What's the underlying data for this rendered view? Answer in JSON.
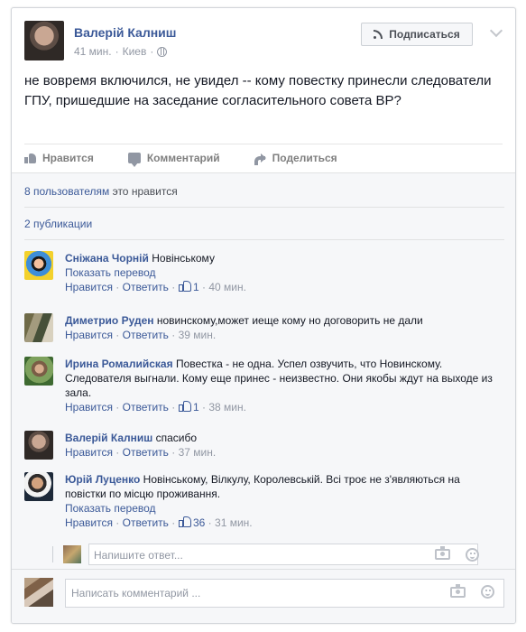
{
  "post": {
    "author": "Валерій Калниш",
    "time": "41 мин.",
    "separator": "·",
    "location": "Киев",
    "follow_label": "Подписаться",
    "text": "не вовремя включился, не увидел -- кому повестку принесли следователи ГПУ, пришедшие на заседание согласительного совета ВР?"
  },
  "actions": {
    "like": "Нравится",
    "comment": "Комментарий",
    "share": "Поделиться"
  },
  "summary": {
    "likes_link": "8 пользователям",
    "likes_rest": " это нравится",
    "shares": "2 публикации"
  },
  "comments": [
    {
      "author": "Сніжана Чорній",
      "text": "Новінському",
      "translate": "Показать перевод",
      "like": "Нравится",
      "dot": "·",
      "reply": "Ответить",
      "likes": "1",
      "time": "40 мин."
    },
    {
      "author": "Диметрио Руден",
      "text": "новинскому,может иеще кому но договорить не дали",
      "like": "Нравится",
      "dot": "·",
      "reply": "Ответить",
      "time": "39 мин."
    },
    {
      "author": "Ирина Ромалийская",
      "text": "Повестка - не одна. Успел озвучить, что Новинскому. Следователя выгнали. Кому еще принес - неизвестно. Они якобы ждут на выходе из зала.",
      "like": "Нравится",
      "dot": "·",
      "reply": "Ответить",
      "likes": "1",
      "time": "38 мин."
    },
    {
      "author": "Валерій Калниш",
      "text": "спасибо",
      "like": "Нравится",
      "dot": "·",
      "reply": "Ответить",
      "time": "37 мин."
    },
    {
      "author": "Юрій Луценко",
      "text": "Новінському, Вілкулу, Королевській. Всі троє не з'являються на повістки по місцю проживання.",
      "translate": "Показать перевод",
      "like": "Нравится",
      "dot": "·",
      "reply": "Ответить",
      "likes": "36",
      "time": "31 мин."
    }
  ],
  "reply_placeholder": "Напишите ответ...",
  "comment_placeholder": "Написать комментарий ...",
  "colors": {
    "link": "#3b5998",
    "meta": "#9197a3",
    "feedback_background": "#f6f7f9"
  },
  "icons": [
    "rss-icon",
    "chevron-down-icon",
    "globe-icon",
    "thumb-up-icon",
    "comment-icon",
    "share-icon",
    "camera-icon",
    "smile-icon"
  ]
}
